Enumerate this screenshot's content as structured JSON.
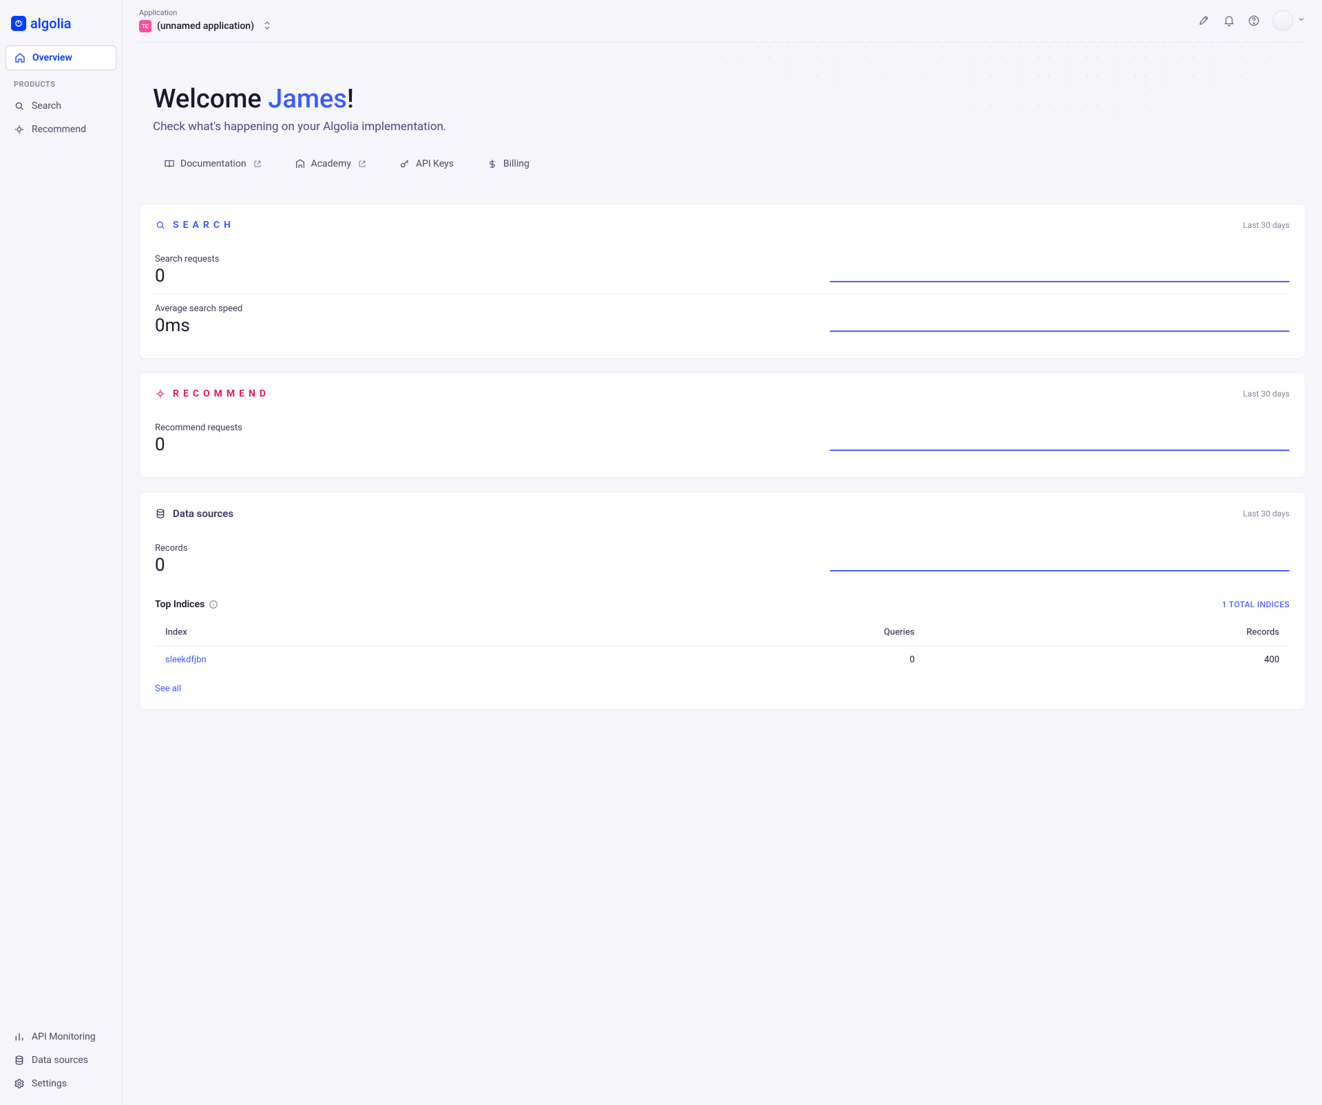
{
  "brand": {
    "name": "algolia"
  },
  "sidebar": {
    "overview": "Overview",
    "products_label": "PRODUCTS",
    "search": "Search",
    "recommend": "Recommend",
    "api_monitoring": "API Monitoring",
    "data_sources": "Data sources",
    "settings": "Settings"
  },
  "topbar": {
    "app_label": "Application",
    "app_badge": "TC",
    "app_name": "(unnamed application)"
  },
  "hero": {
    "welcome_prefix": "Welcome ",
    "user_name": "James",
    "welcome_suffix": "!",
    "subtitle": "Check what's happening on your Algolia implementation.",
    "links": {
      "docs": "Documentation",
      "academy": "Academy",
      "api_keys": "API Keys",
      "billing": "Billing"
    }
  },
  "period_label": "Last 30 days",
  "search_card": {
    "title": "SEARCH",
    "requests_label": "Search requests",
    "requests_value": "0",
    "speed_label": "Average search speed",
    "speed_value": "0ms"
  },
  "recommend_card": {
    "title": "RECOMMEND",
    "requests_label": "Recommend requests",
    "requests_value": "0"
  },
  "datasource_card": {
    "title": "Data sources",
    "records_label": "Records",
    "records_value": "0",
    "top_indices_label": "Top Indices",
    "total_indices": "1 TOTAL INDICES",
    "columns": {
      "index": "Index",
      "queries": "Queries",
      "records": "Records"
    },
    "rows": [
      {
        "name": "sleekdfjbn",
        "queries": "0",
        "records": "400"
      }
    ],
    "see_all": "See all"
  },
  "chart_data": [
    {
      "type": "line",
      "title": "Search requests",
      "x": [],
      "values": [
        0
      ],
      "ylim": [
        0,
        1
      ]
    },
    {
      "type": "line",
      "title": "Average search speed (ms)",
      "x": [],
      "values": [
        0
      ],
      "ylim": [
        0,
        1
      ]
    },
    {
      "type": "line",
      "title": "Recommend requests",
      "x": [],
      "values": [
        0
      ],
      "ylim": [
        0,
        1
      ]
    },
    {
      "type": "line",
      "title": "Records",
      "x": [],
      "values": [
        0
      ],
      "ylim": [
        0,
        1
      ]
    }
  ]
}
